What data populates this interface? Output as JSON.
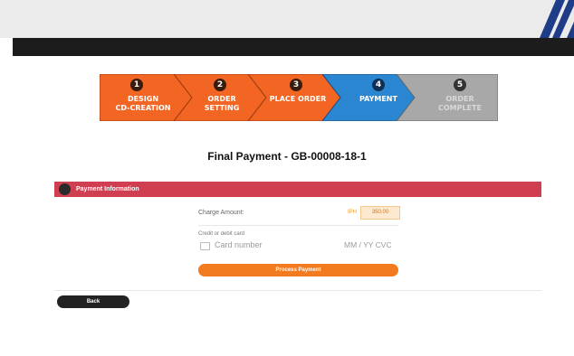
{
  "steps": [
    {
      "number": "1",
      "label": "DESIGN\nCD-CREATION",
      "state": "done",
      "color": "#f26522"
    },
    {
      "number": "2",
      "label": "ORDER\nSETTING",
      "state": "done",
      "color": "#f26522"
    },
    {
      "number": "3",
      "label": "PLACE ORDER",
      "state": "done",
      "color": "#f26522"
    },
    {
      "number": "4",
      "label": "PAYMENT",
      "state": "active",
      "color": "#2a86d1"
    },
    {
      "number": "5",
      "label": "ORDER\nCOMPLETE",
      "state": "pending",
      "color": "#a8a8a8"
    }
  ],
  "page": {
    "title": "Final Payment - GB-00008-18-1"
  },
  "payment": {
    "header": "Payment Information",
    "charge_label": "Charge Amount:",
    "currency": "IPH",
    "amount": "350.00",
    "card_label": "Credit or debit card",
    "card_number_placeholder": "Card number",
    "expiry_cvc_placeholder": "MM / YY  CVC",
    "process_label": "Process Payment"
  },
  "back_label": "Back",
  "colors": {
    "accent_orange": "#f47a1f",
    "header_red": "#cf3f51",
    "active_blue": "#2a86d1",
    "top_dark": "#1c1c1c"
  }
}
